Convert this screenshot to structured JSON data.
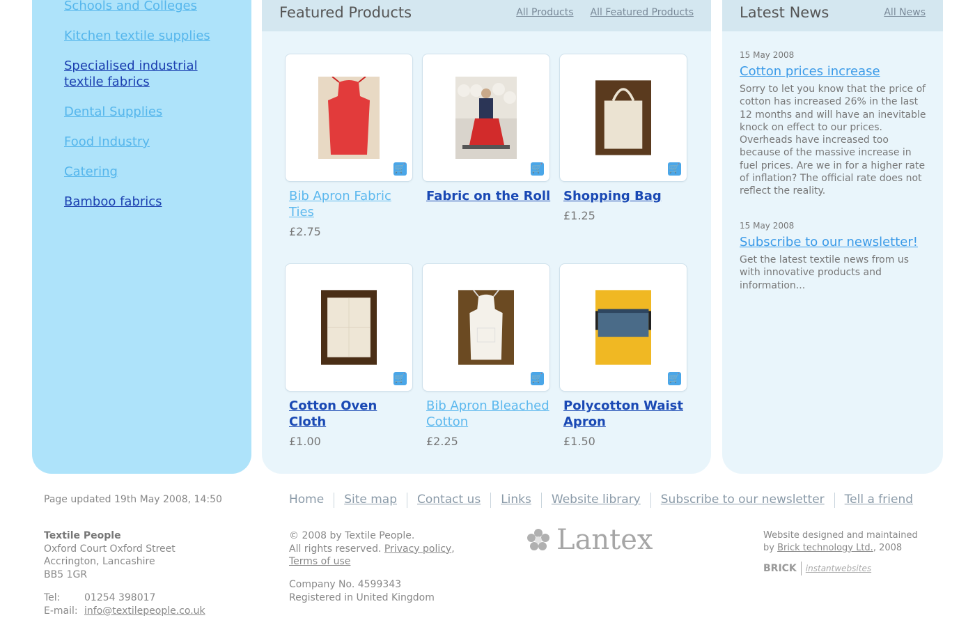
{
  "sidebar": {
    "items": [
      {
        "label": "Schools and Colleges",
        "style": "light"
      },
      {
        "label": "Kitchen textile supplies",
        "style": "light"
      },
      {
        "label": "Specialised industrial textile fabrics",
        "style": "dark"
      },
      {
        "label": "Dental Supplies",
        "style": "light"
      },
      {
        "label": "Food Industry",
        "style": "light"
      },
      {
        "label": "Catering",
        "style": "light"
      },
      {
        "label": "Bamboo fabrics",
        "style": "dark"
      }
    ]
  },
  "featured": {
    "title": "Featured Products",
    "links": [
      "All Products",
      "All Featured Products"
    ],
    "products": [
      {
        "name": "Bib Apron Fabric Ties",
        "price": "£2.75",
        "image": "red-apron-image"
      },
      {
        "name": "Fabric on the Roll",
        "price": "",
        "image": "fabric-roll-image"
      },
      {
        "name": "Shopping Bag",
        "price": "£1.25",
        "image": "shopping-bag-image"
      },
      {
        "name": "Cotton Oven Cloth",
        "price": "£1.00",
        "image": "oven-cloth-image"
      },
      {
        "name": "Bib Apron Bleached Cotton",
        "price": "£2.25",
        "image": "white-apron-image"
      },
      {
        "name": "Polycotton Waist Apron",
        "price": "£1.50",
        "image": "waist-apron-image"
      }
    ]
  },
  "news": {
    "title": "Latest News",
    "link": "All News",
    "items": [
      {
        "date": "15 May 2008",
        "title": "Cotton prices increase",
        "body": "Sorry to let you know that the price of cotton has increased 26% in the last 12 months and will have an inevitable knock on effect to our prices. Overheads have increased too because of the massive increase in fuel prices. Are we in for a higher rate of inflation? The official rate does not reflect the reality."
      },
      {
        "date": "15 May 2008",
        "title": "Subscribe to our newsletter!",
        "body": "Get the latest textile news from us with innovative products and information..."
      }
    ]
  },
  "footer": {
    "updated": "Page updated 19th May 2008, 14:50",
    "nav": [
      "Home",
      "Site map",
      "Contact us",
      "Links",
      "Website library",
      "Subscribe to our newsletter",
      "Tell a friend"
    ],
    "company": "Textile People",
    "address": [
      "Oxford Court Oxford Street",
      "Accrington, Lancashire",
      "BB5 1GR"
    ],
    "tel_label": "Tel:",
    "tel": "01254 398017",
    "email_label": "E-mail:",
    "email": "info@textilepeople.co.uk",
    "copyright": "© 2008 by Textile People.",
    "rights": "All rights reserved.",
    "privacy": "Privacy policy",
    "terms": "Terms of use",
    "company_no": "Company No. 4599343",
    "registered": "Registered in United Kingdom",
    "logo_text": "Lantex",
    "designed_line1": "Website designed and maintained",
    "designed_by": "by",
    "designer": "Brick technology Ltd.",
    "designed_year": ", 2008",
    "brick": "BRICK",
    "instant": "instantwebsites"
  },
  "colors": {
    "sidebar_bg": "#aee3fa",
    "panel_bg": "#e9f5fb",
    "header_bg": "#d4e7f0",
    "link_dark": "#1a49b4",
    "link_light": "#5cb8ee",
    "cart": "#4aa6e8"
  }
}
